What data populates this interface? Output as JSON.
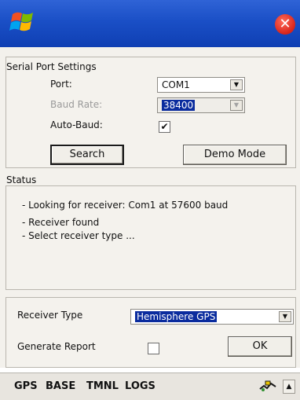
{
  "window": {
    "close_label": "✕"
  },
  "serial_port": {
    "title": "Serial Port Settings",
    "port_label": "Port:",
    "port_value": "COM1",
    "baud_label": "Baud Rate:",
    "baud_value": "38400",
    "auto_baud_label": "Auto-Baud:",
    "auto_baud_checked": true,
    "search_label": "Search",
    "demo_label": "Demo Mode"
  },
  "status": {
    "title": "Status",
    "lines": [
      "- Looking for receiver: Com1 at 57600 baud",
      "- Receiver found",
      "- Select receiver type ..."
    ]
  },
  "receiver": {
    "type_label": "Receiver Type",
    "type_value": "Hemisphere GPS",
    "report_label": "Generate Report",
    "report_checked": false,
    "ok_label": "OK"
  },
  "taskbar": {
    "items": [
      "GPS",
      "BASE",
      "TMNL",
      "LOGS"
    ],
    "up_arrow": "▲"
  },
  "icons": {
    "windows_logo": "windows-flag-icon",
    "tray": "gps-tray-icon"
  },
  "colors": {
    "titlebar": "#1a4fc6",
    "selection": "#0a2c9e",
    "close": "#d8241a"
  }
}
